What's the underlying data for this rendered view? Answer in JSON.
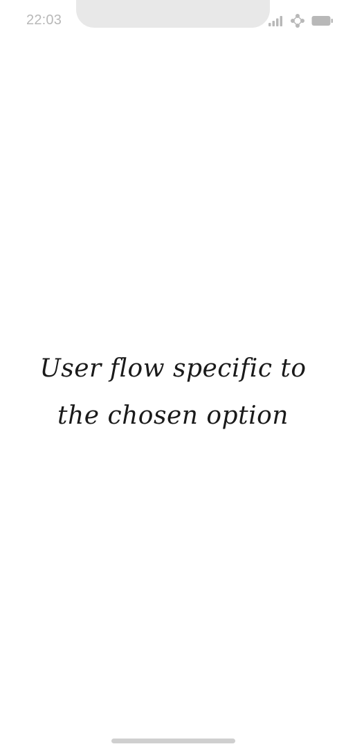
{
  "status_bar": {
    "time": "22:03",
    "icons": [
      "signal-icon",
      "wifi-icon",
      "battery-icon"
    ],
    "icon_color": "#b8b8b8"
  },
  "main": {
    "message_line1": "User flow specific to",
    "message_line2": "the chosen option"
  },
  "colors": {
    "background": "#ffffff",
    "text": "#1a1a1a",
    "notch": "#e8e8e8",
    "home_indicator": "#cfcfcf"
  }
}
